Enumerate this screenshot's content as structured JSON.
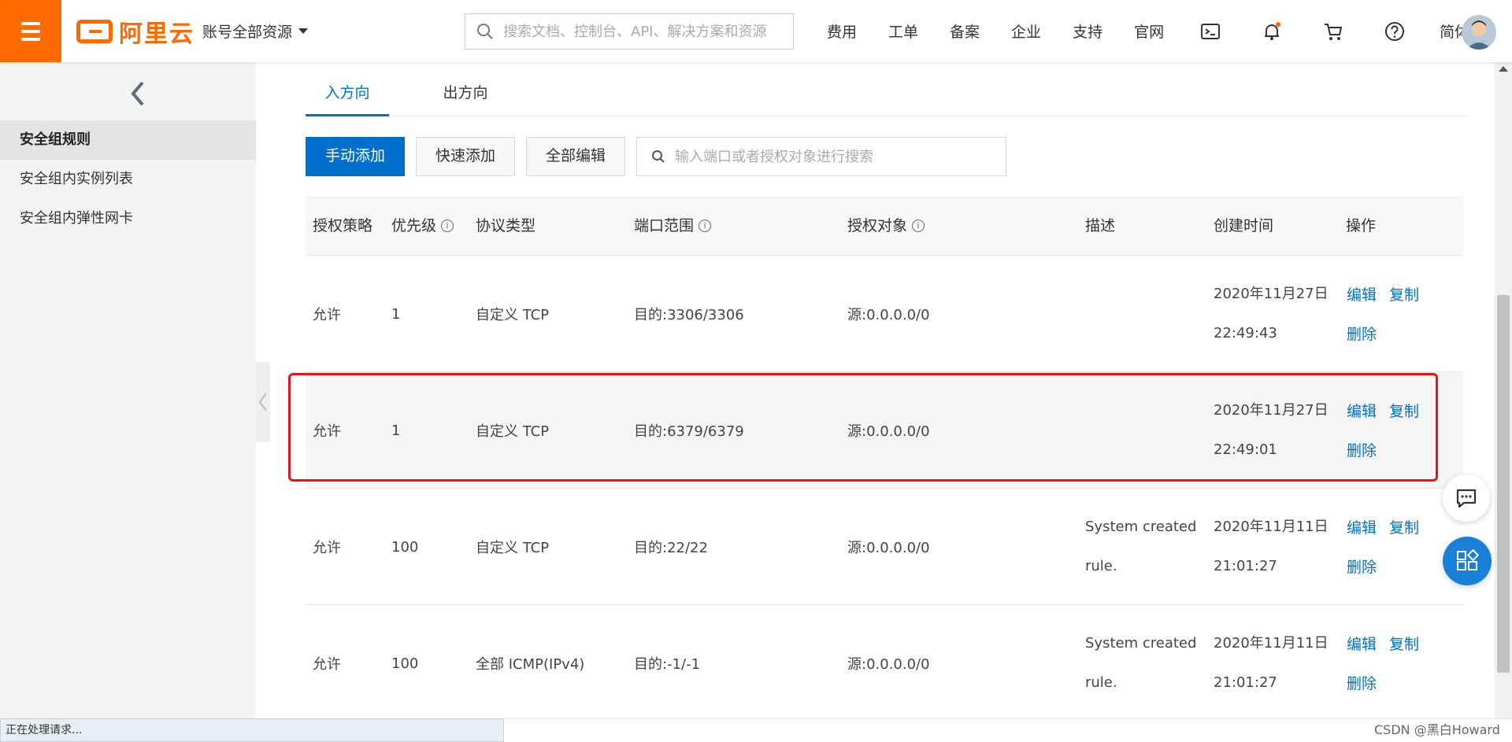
{
  "header": {
    "logo_text": "阿里云",
    "account_label": "账号全部资源",
    "search_placeholder": "搜索文档、控制台、API、解决方案和资源",
    "nav": [
      "费用",
      "工单",
      "备案",
      "企业",
      "支持",
      "官网"
    ],
    "icons": [
      "terminal-icon",
      "bell-icon",
      "cart-icon",
      "help-icon"
    ],
    "language": "简体"
  },
  "sidebar": {
    "items": [
      {
        "label": "安全组规则",
        "active": true
      },
      {
        "label": "安全组内实例列表",
        "active": false
      },
      {
        "label": "安全组内弹性网卡",
        "active": false
      }
    ]
  },
  "tabs": [
    {
      "label": "入方向",
      "active": true
    },
    {
      "label": "出方向",
      "active": false
    }
  ],
  "toolbar": {
    "manual_add": "手动添加",
    "quick_add": "快速添加",
    "edit_all": "全部编辑",
    "search_placeholder": "输入端口或者授权对象进行搜索"
  },
  "table": {
    "headers": {
      "policy": "授权策略",
      "priority": "优先级",
      "protocol": "协议类型",
      "port": "端口范围",
      "source": "授权对象",
      "desc": "描述",
      "created": "创建时间",
      "actions": "操作"
    },
    "rows": [
      {
        "policy": "允许",
        "priority": "1",
        "protocol": "自定义 TCP",
        "port": "目的:3306/3306",
        "source": "源:0.0.0.0/0",
        "desc1": "",
        "desc2": "",
        "date": "2020年11月27日",
        "time": "22:49:43"
      },
      {
        "policy": "允许",
        "priority": "1",
        "protocol": "自定义 TCP",
        "port": "目的:6379/6379",
        "source": "源:0.0.0.0/0",
        "desc1": "",
        "desc2": "",
        "date": "2020年11月27日",
        "time": "22:49:01"
      },
      {
        "policy": "允许",
        "priority": "100",
        "protocol": "自定义 TCP",
        "port": "目的:22/22",
        "source": "源:0.0.0.0/0",
        "desc1": "System created",
        "desc2": "rule.",
        "date": "2020年11月11日",
        "time": "21:01:27"
      },
      {
        "policy": "允许",
        "priority": "100",
        "protocol": "全部 ICMP(IPv4)",
        "port": "目的:-1/-1",
        "source": "源:0.0.0.0/0",
        "desc1": "System created",
        "desc2": "rule.",
        "date": "2020年11月11日",
        "time": "21:01:27"
      }
    ],
    "action_labels": {
      "edit": "编辑",
      "copy": "复制",
      "delete": "删除"
    }
  },
  "status_bar": "正在处理请求...",
  "watermark": "CSDN @黑白Howard",
  "colors": {
    "brand": "#ff6a00",
    "primary": "#0070cc",
    "highlight_border": "#e8141c"
  }
}
